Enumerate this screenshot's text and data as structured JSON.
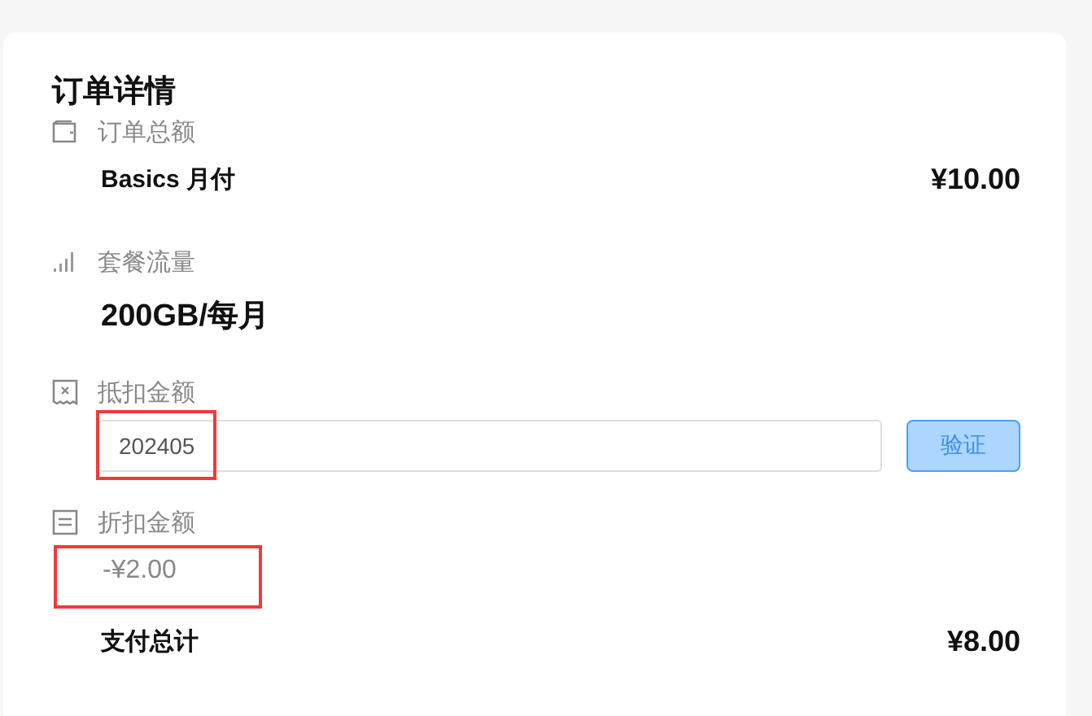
{
  "title": "订单详情",
  "sections": [
    {
      "kind": "amount",
      "label": "订单总额",
      "name": "Basics 月付",
      "price": "¥10.00"
    },
    {
      "kind": "plan",
      "label": "套餐流量",
      "value": "200GB/每月"
    },
    {
      "kind": "coupon",
      "label": "抵扣金额",
      "field": {
        "value": "202405",
        "highlighted": true
      },
      "button": {
        "label": "验证",
        "disabled": true
      }
    },
    {
      "kind": "discount",
      "label": "折扣金额",
      "value": "-¥2.00",
      "highlighted": true
    }
  ],
  "total": {
    "label": "支付总计",
    "price": "¥8.00"
  }
}
